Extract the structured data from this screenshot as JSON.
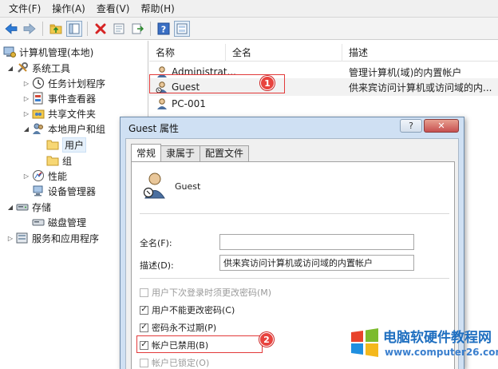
{
  "menu": [
    {
      "label": "文件(F)"
    },
    {
      "label": "操作(A)"
    },
    {
      "label": "查看(V)"
    },
    {
      "label": "帮助(H)"
    }
  ],
  "toolbar": {
    "icons": [
      "back-arrow-icon",
      "forward-arrow-icon",
      "up-folder-icon",
      "show-tree-icon",
      "delete-icon",
      "properties-icon",
      "export-icon",
      "help-icon",
      "view-icon"
    ]
  },
  "tree": {
    "root": "计算机管理(本地)",
    "system_tools": "系统工具",
    "task_scheduler": "任务计划程序",
    "event_viewer": "事件查看器",
    "shared_folders": "共享文件夹",
    "local_users": "本地用户和组",
    "users": "用户",
    "groups": "组",
    "performance": "性能",
    "device_manager": "设备管理器",
    "storage": "存储",
    "disk_management": "磁盘管理",
    "services": "服务和应用程序"
  },
  "list": {
    "columns": [
      "名称",
      "全名",
      "描述"
    ],
    "rows": [
      {
        "name": "Administrat...",
        "fullname": "",
        "desc": "管理计算机(域)的内置帐户"
      },
      {
        "name": "Guest",
        "fullname": "",
        "desc": "供来宾访问计算机或访问域的内..."
      },
      {
        "name": "PC-001",
        "fullname": "",
        "desc": ""
      }
    ]
  },
  "badges": [
    "1",
    "2"
  ],
  "dialog": {
    "title": "Guest 属性",
    "help_btn": "?",
    "close_btn": "✕",
    "tabs": [
      "常规",
      "隶属于",
      "配置文件"
    ],
    "username": "Guest",
    "fullname_label": "全名(F):",
    "fullname_value": "",
    "desc_label": "描述(D):",
    "desc_value": "供来宾访问计算机或访问域的内置帐户",
    "checkboxes": [
      {
        "label": "用户下次登录时须更改密码(M)",
        "checked": false,
        "disabled": true
      },
      {
        "label": "用户不能更改密码(C)",
        "checked": true,
        "disabled": false
      },
      {
        "label": "密码永不过期(P)",
        "checked": true,
        "disabled": false
      },
      {
        "label": "帐户已禁用(B)",
        "checked": true,
        "disabled": false
      },
      {
        "label": "帐户已锁定(O)",
        "checked": false,
        "disabled": true
      }
    ]
  },
  "watermark": {
    "title": "电脑软硬件教程网",
    "url": "www.computer26.com"
  },
  "colors": {
    "accent_red": "#e8433e",
    "watermark_blue": "#1f6fc0"
  }
}
